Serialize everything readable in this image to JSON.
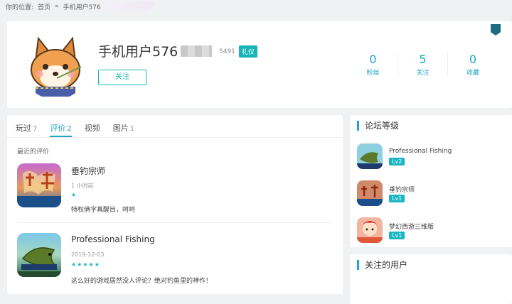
{
  "breadcrumb": {
    "prefix": "你的位置:",
    "home": "首页",
    "sep": "»",
    "current": "手机用户576"
  },
  "profile": {
    "username": "手机用户576",
    "uid": "5491",
    "badge": "礼仪",
    "follow_label": "关注",
    "stats": [
      {
        "value": "0",
        "label": "粉丝"
      },
      {
        "value": "5",
        "label": "关注"
      },
      {
        "value": "0",
        "label": "收藏"
      }
    ]
  },
  "tabs": [
    {
      "label": "玩过",
      "count": "7"
    },
    {
      "label": "评价",
      "count": "2"
    },
    {
      "label": "视频",
      "count": ""
    },
    {
      "label": "图片",
      "count": "1"
    }
  ],
  "recent_label": "最近的评价",
  "reviews": [
    {
      "game": "垂钓宗师",
      "time": "1 小时前",
      "stars": "★",
      "text": "特权俩字真醒目，呵呵"
    },
    {
      "game": "Professional Fishing",
      "time": "2019-12-03",
      "stars": "★★★★★",
      "text": "这么好的游戏居然没人评论？绝对钓鱼里的神作！"
    }
  ],
  "forum": {
    "title": "论坛等级",
    "items": [
      {
        "name": "Professional Fishing",
        "level": "Lv2"
      },
      {
        "name": "垂钓宗师",
        "level": "Lv1"
      },
      {
        "name": "梦幻西游三维版",
        "level": "Lv1"
      }
    ]
  },
  "followed_title": "关注的用户",
  "colors": {
    "accent": "#1aa6c8",
    "badge": "#15b5b5"
  }
}
